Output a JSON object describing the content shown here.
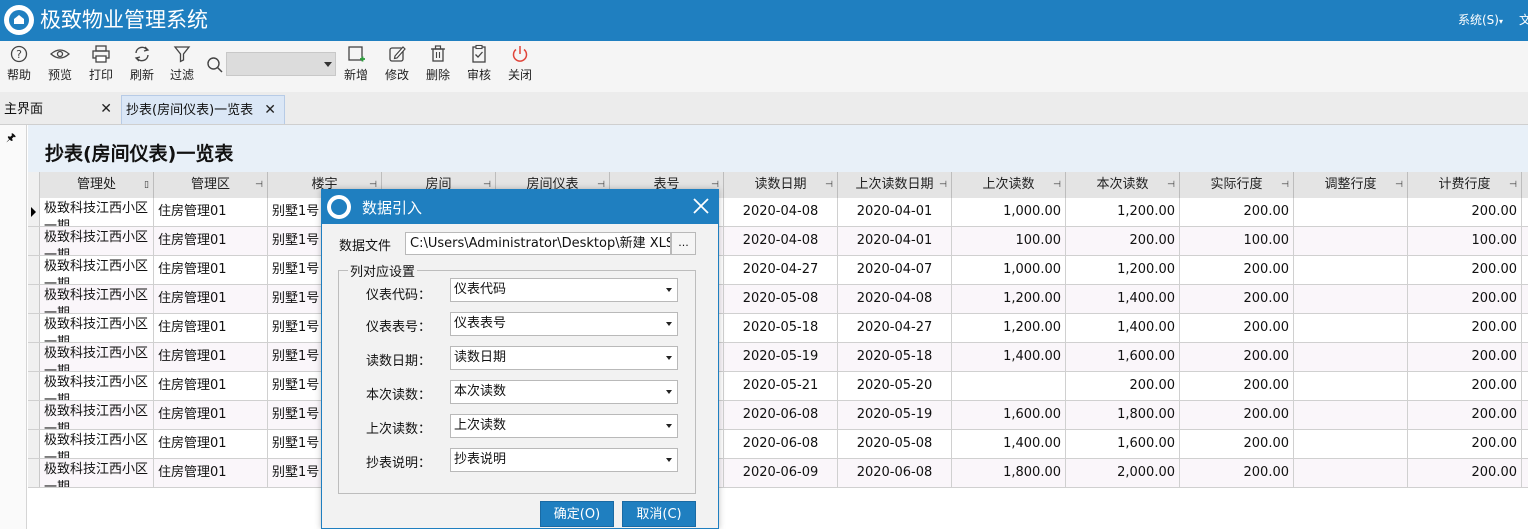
{
  "app": {
    "title": "极致物业管理系统",
    "system_menu": "系统(S)",
    "system_extra": "文"
  },
  "toolbar": {
    "help": "帮助",
    "preview": "预览",
    "print": "打印",
    "refresh": "刷新",
    "filter": "过滤",
    "add": "新增",
    "edit": "修改",
    "delete": "删除",
    "audit": "审核",
    "close": "关闭",
    "combo_value": ""
  },
  "tabs": [
    {
      "label": "主界面"
    },
    {
      "label": "抄表(房间仪表)一览表"
    }
  ],
  "page": {
    "title": "抄表(房间仪表)一览表"
  },
  "grid": {
    "columns": [
      "管理处",
      "管理区",
      "楼宇",
      "房间",
      "房间仪表",
      "表号",
      "读数日期",
      "上次读数日期",
      "上次读数",
      "本次读数",
      "实际行度",
      "调整行度",
      "计费行度"
    ],
    "rows": [
      {
        "dept": "极致科技江西小区一期",
        "area": "住房管理01",
        "bldg": "别墅1号",
        "date": "2020-04-08",
        "last_date": "2020-04-01",
        "last_read": "1,000.00",
        "this_read": "1,200.00",
        "actual": "200.00",
        "adjust": "",
        "billing": "200.00"
      },
      {
        "dept": "极致科技江西小区一期",
        "area": "住房管理01",
        "bldg": "别墅1号",
        "date": "2020-04-08",
        "last_date": "2020-04-01",
        "last_read": "100.00",
        "this_read": "200.00",
        "actual": "100.00",
        "adjust": "",
        "billing": "100.00"
      },
      {
        "dept": "极致科技江西小区一期",
        "area": "住房管理01",
        "bldg": "别墅1号",
        "date": "2020-04-27",
        "last_date": "2020-04-07",
        "last_read": "1,000.00",
        "this_read": "1,200.00",
        "actual": "200.00",
        "adjust": "",
        "billing": "200.00"
      },
      {
        "dept": "极致科技江西小区一期",
        "area": "住房管理01",
        "bldg": "别墅1号",
        "date": "2020-05-08",
        "last_date": "2020-04-08",
        "last_read": "1,200.00",
        "this_read": "1,400.00",
        "actual": "200.00",
        "adjust": "",
        "billing": "200.00"
      },
      {
        "dept": "极致科技江西小区一期",
        "area": "住房管理01",
        "bldg": "别墅1号",
        "date": "2020-05-18",
        "last_date": "2020-04-27",
        "last_read": "1,200.00",
        "this_read": "1,400.00",
        "actual": "200.00",
        "adjust": "",
        "billing": "200.00"
      },
      {
        "dept": "极致科技江西小区一期",
        "area": "住房管理01",
        "bldg": "别墅1号",
        "date": "2020-05-19",
        "last_date": "2020-05-18",
        "last_read": "1,400.00",
        "this_read": "1,600.00",
        "actual": "200.00",
        "adjust": "",
        "billing": "200.00"
      },
      {
        "dept": "极致科技江西小区一期",
        "area": "住房管理01",
        "bldg": "别墅1号",
        "date": "2020-05-21",
        "last_date": "2020-05-20",
        "last_read": "",
        "this_read": "200.00",
        "actual": "200.00",
        "adjust": "",
        "billing": "200.00"
      },
      {
        "dept": "极致科技江西小区一期",
        "area": "住房管理01",
        "bldg": "别墅1号",
        "date": "2020-06-08",
        "last_date": "2020-05-19",
        "last_read": "1,600.00",
        "this_read": "1,800.00",
        "actual": "200.00",
        "adjust": "",
        "billing": "200.00"
      },
      {
        "dept": "极致科技江西小区一期",
        "area": "住房管理01",
        "bldg": "别墅1号",
        "date": "2020-06-08",
        "last_date": "2020-05-08",
        "last_read": "1,400.00",
        "this_read": "1,600.00",
        "actual": "200.00",
        "adjust": "",
        "billing": "200.00"
      },
      {
        "dept": "极致科技江西小区一期",
        "area": "住房管理01",
        "bldg": "别墅1号",
        "date": "2020-06-09",
        "last_date": "2020-06-08",
        "last_read": "1,800.00",
        "this_read": "2,000.00",
        "actual": "200.00",
        "adjust": "",
        "billing": "200.00"
      }
    ]
  },
  "dialog": {
    "title": "数据引入",
    "file_label": "数据文件",
    "file_value": "C:\\Users\\Administrator\\Desktop\\新建 XLS 工作表.xls",
    "browse": "...",
    "group_label": "列对应设置",
    "mappings": [
      {
        "label": "仪表代码：",
        "value": "仪表代码"
      },
      {
        "label": "仪表表号：",
        "value": "仪表表号"
      },
      {
        "label": "读数日期：",
        "value": "读数日期"
      },
      {
        "label": "本次读数：",
        "value": "本次读数"
      },
      {
        "label": "上次读数：",
        "value": "上次读数"
      },
      {
        "label": "抄表说明：",
        "value": "抄表说明"
      }
    ],
    "ok": "确定(O)",
    "cancel": "取消(C)"
  }
}
